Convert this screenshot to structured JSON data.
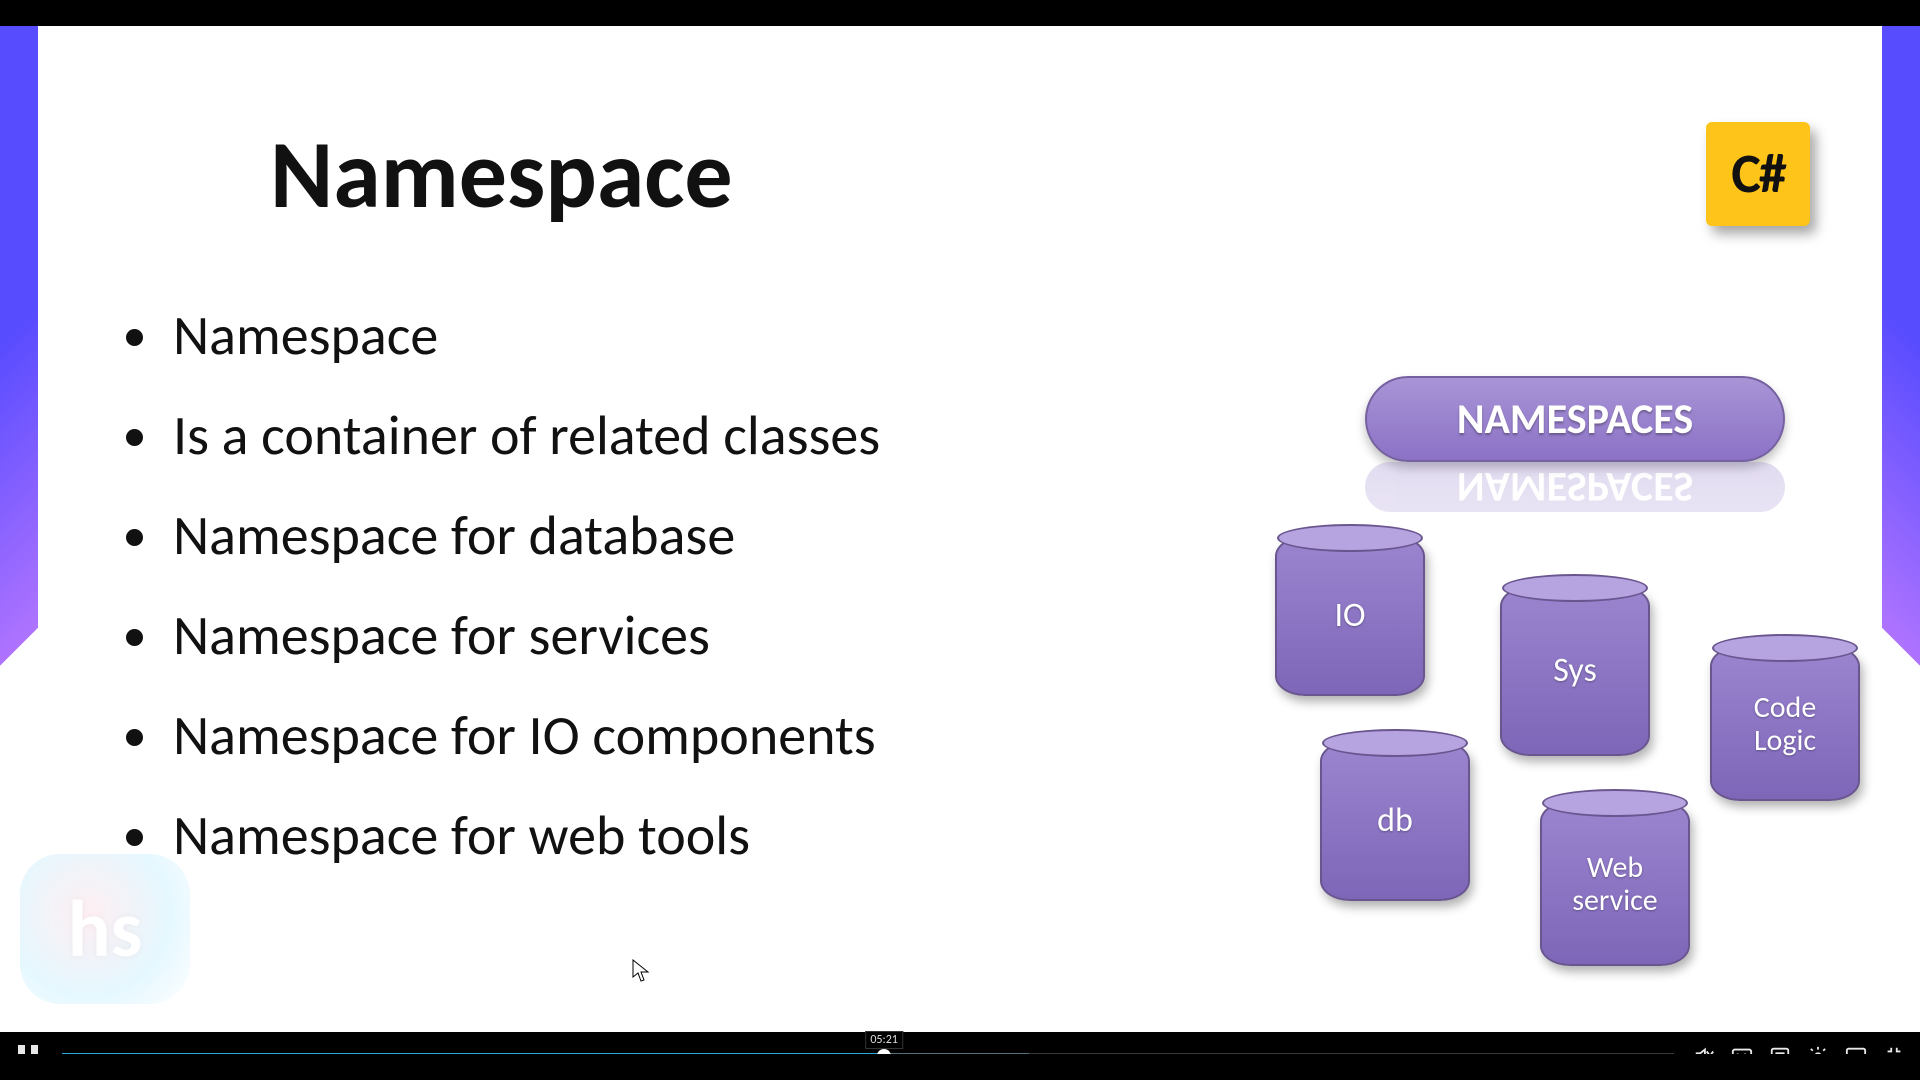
{
  "slide": {
    "title": "Namespace",
    "bullets": [
      "Namespace",
      "Is a container of related classes",
      "Namespace for database",
      "Namespace for services",
      "Namespace for IO components",
      "Namespace for web tools"
    ],
    "logo": {
      "text": "C#",
      "bg": "#ffc419"
    },
    "watermark": "hs"
  },
  "diagram": {
    "header": "NAMESPACES",
    "cylinders": {
      "io": "IO",
      "sys": "Sys",
      "code": "Code Logic",
      "db": "db",
      "web": "Web service"
    }
  },
  "player": {
    "state": "paused-icon-shows-pause",
    "position_time": "05:21",
    "progress_pct": 51,
    "loaded_pct": 60
  },
  "colors": {
    "cylinder": "#8c72c6",
    "pill": "#8c72c6",
    "accent_blue": "#2aa9e0"
  }
}
